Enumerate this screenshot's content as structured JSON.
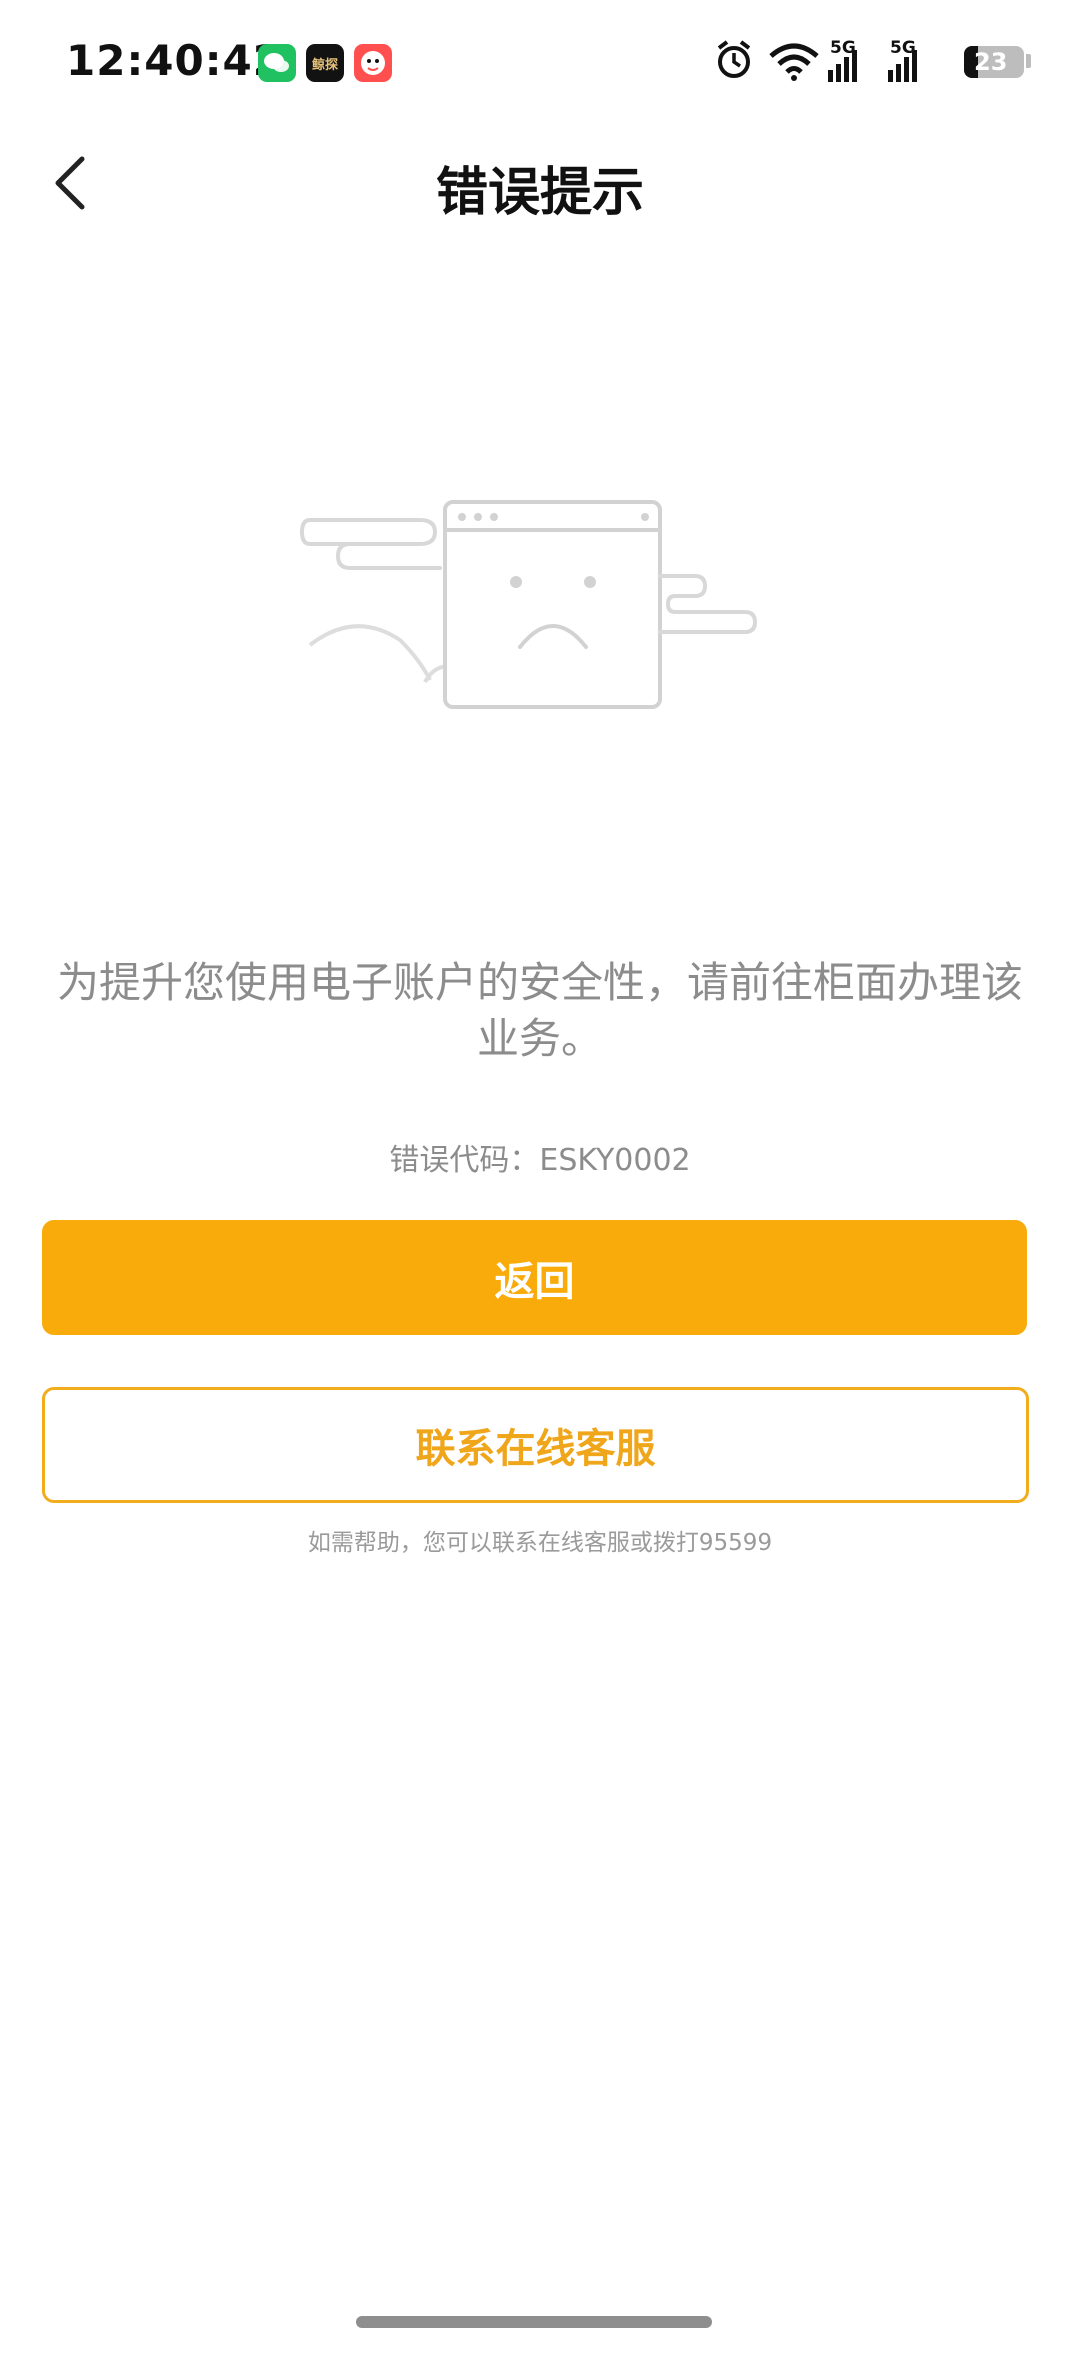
{
  "status_bar": {
    "time": "12:40:42",
    "network_1": "5G",
    "network_2": "5G",
    "battery": "23",
    "battery_level": 0.23,
    "app_icons": [
      "wechat-icon",
      "dark-app-icon",
      "red-app-icon"
    ],
    "dark_app_text": "鲸探"
  },
  "header": {
    "title": "错误提示",
    "back_icon": "chevron-left-icon"
  },
  "error": {
    "message": "为提升您使用电子账户的安全性，请前往柜面办理该业务。",
    "code": "错误代码：ESKY0002"
  },
  "actions": {
    "primary_label": "返回",
    "secondary_label": "联系在线客服"
  },
  "help": {
    "text": "如需帮助，您可以联系在线客服或拨打95599"
  },
  "colors": {
    "accent": "#f9ab0b",
    "text_muted": "#8c8c8c",
    "outline": "#f2ad1c"
  }
}
